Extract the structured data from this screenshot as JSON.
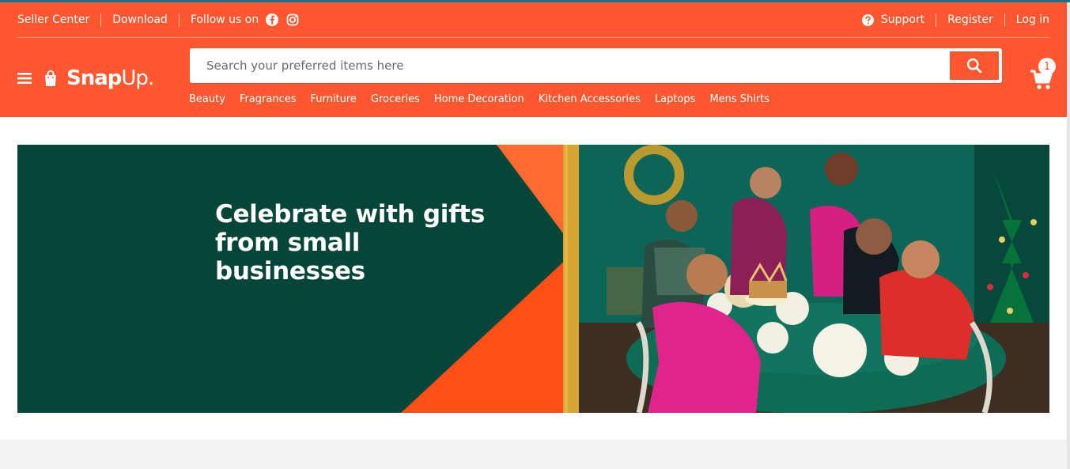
{
  "topbar": {
    "left": [
      "Seller Center",
      "Download"
    ],
    "follow": "Follow us on",
    "social": [
      "facebook-icon",
      "instagram-icon"
    ],
    "right": [
      "Support",
      "Register",
      "Log in"
    ]
  },
  "brand": {
    "name": "Snap",
    "suffix": "Up."
  },
  "search": {
    "placeholder": "Search your preferred items here"
  },
  "cart": {
    "count": "1"
  },
  "categories": [
    "Beauty",
    "Fragrances",
    "Furniture",
    "Groceries",
    "Home Decoration",
    "Kitchen Accessories",
    "Laptops",
    "Mens Shirts"
  ],
  "banner": {
    "headline": "Celebrate with gifts from small businesses",
    "colors": {
      "green": "#064638",
      "orange": "#ff4f17",
      "gold": "#d6a533",
      "pink": "#e1238d",
      "red": "#dd2f2a"
    }
  },
  "theme": {
    "brand_orange": "#ff5831"
  }
}
